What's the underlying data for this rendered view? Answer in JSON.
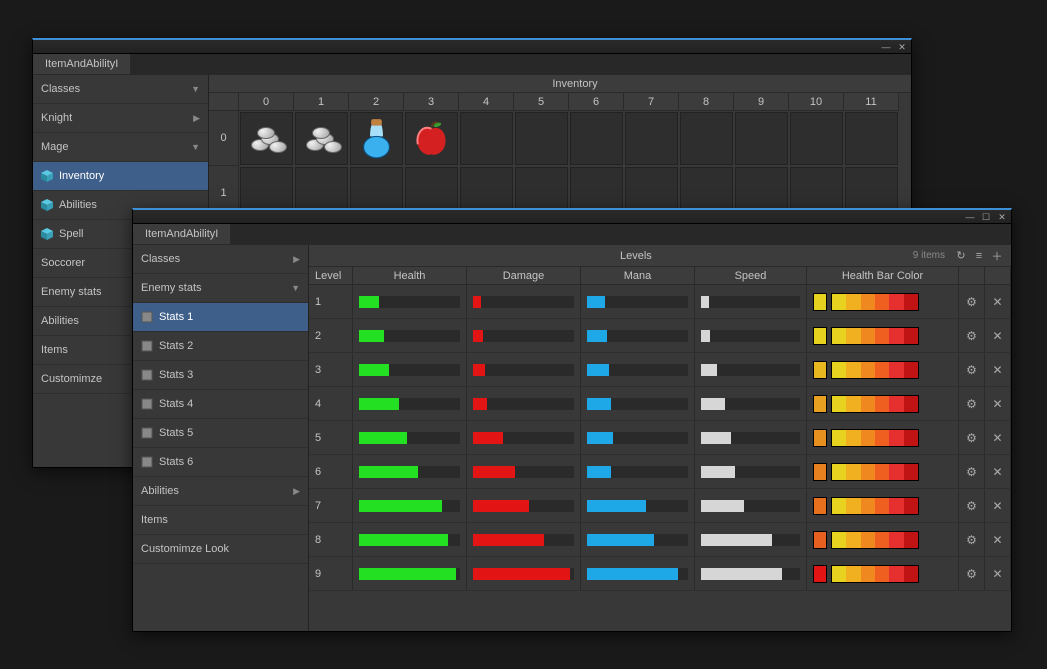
{
  "window1": {
    "tab": "ItemAndAbilityI",
    "sidebar": {
      "classes": "Classes",
      "knight": "Knight",
      "mage": "Mage",
      "inventory": "Inventory",
      "abilities": "Abilities",
      "spells": "Spell",
      "soccorer": "Soccorer",
      "enemy": "Enemy stats",
      "abilities2": "Abilities",
      "items": "Items",
      "custom": "Customimze"
    },
    "inventory": {
      "title": "Inventory",
      "cols": [
        "0",
        "1",
        "2",
        "3",
        "4",
        "5",
        "6",
        "7",
        "8",
        "9",
        "10",
        "11"
      ],
      "rows": [
        "0",
        "1"
      ],
      "slots": [
        [
          {
            "icon": "coins"
          },
          {
            "icon": "coins"
          },
          {
            "icon": "potion"
          },
          {
            "icon": "apple"
          },
          null,
          null,
          null,
          null,
          null,
          null,
          null,
          null
        ],
        [
          null,
          null,
          null,
          null,
          null,
          null,
          null,
          null,
          null,
          null,
          null,
          null
        ]
      ]
    }
  },
  "window2": {
    "tab": "ItemAndAbilityI",
    "sidebar": {
      "classes": "Classes",
      "enemy": "Enemy stats",
      "stats": [
        "Stats 1",
        "Stats 2",
        "Stats 3",
        "Stats 4",
        "Stats 5",
        "Stats 6"
      ],
      "abilities": "Abilities",
      "items": "Items",
      "custom": "Customimze Look"
    },
    "levels": {
      "title": "Levels",
      "meta": "9 items",
      "cols": [
        "Level",
        "Health",
        "Damage",
        "Mana",
        "Speed",
        "Health Bar Color"
      ],
      "rows": [
        {
          "lv": "1",
          "h": 20,
          "d": 8,
          "m": 18,
          "s": 8,
          "sw": "#e7d21f"
        },
        {
          "lv": "2",
          "h": 25,
          "d": 10,
          "m": 20,
          "s": 9,
          "sw": "#e7d21f"
        },
        {
          "lv": "3",
          "h": 30,
          "d": 12,
          "m": 22,
          "s": 16,
          "sw": "#e7b81f"
        },
        {
          "lv": "4",
          "h": 40,
          "d": 14,
          "m": 24,
          "s": 24,
          "sw": "#e7a01f"
        },
        {
          "lv": "5",
          "h": 48,
          "d": 30,
          "m": 26,
          "s": 30,
          "sw": "#e7901f"
        },
        {
          "lv": "6",
          "h": 58,
          "d": 42,
          "m": 24,
          "s": 34,
          "sw": "#e7801f"
        },
        {
          "lv": "7",
          "h": 82,
          "d": 55,
          "m": 58,
          "s": 44,
          "sw": "#e7701f"
        },
        {
          "lv": "8",
          "h": 88,
          "d": 70,
          "m": 66,
          "s": 72,
          "sw": "#e7601f"
        },
        {
          "lv": "9",
          "h": 96,
          "d": 96,
          "m": 90,
          "s": 82,
          "sw": "#e31414"
        }
      ],
      "grad": [
        "#e7d21f",
        "#f0b020",
        "#f08820",
        "#ef6020",
        "#e63030",
        "#c01414"
      ],
      "colors": {
        "h": "#23e023",
        "d": "#e31414",
        "m": "#1fa8e7",
        "s": "#d6d6d6"
      }
    }
  }
}
